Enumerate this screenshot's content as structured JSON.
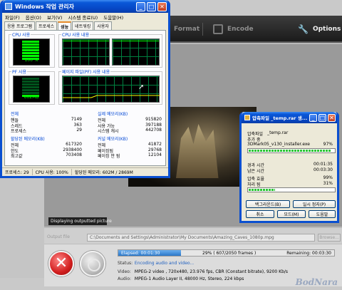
{
  "encoder": {
    "toolbar": {
      "format_label": "Format",
      "encode_label": "Encode",
      "options_label": "Options"
    },
    "preview_status": "Displaying outputted picture",
    "output_label": "Output file",
    "output_path": "C:\\Documents and Settings\\Administrator\\My Documents\\Amazing_Caves_1080p.mpg",
    "browse_label": "Browse...",
    "progress": {
      "elapsed": "Elapsed: 00:01:30",
      "frames": "29% ( 607/2050 frames )",
      "remaining": "Remaining: 00:03:30",
      "percent": 29
    },
    "status_key": "Status:",
    "status_val": "Encoding audio and video...",
    "video_key": "Video:",
    "video_val": "MPEG-2 video , 720x480, 23.976 fps, CBR (Constant bitrate), 9200 Kb/s",
    "audio_key": "Audio:",
    "audio_val": "MPEG-1 Audio Layer II, 48000 Hz, Stereo, 224 kbps",
    "watermark": "BodNara"
  },
  "taskmgr": {
    "title": "Windows 작업 관리자",
    "menu": [
      "파일(F)",
      "옵션(O)",
      "보기(V)",
      "시스템 종료(U)",
      "도움말(H)"
    ],
    "tabs": [
      "응용 프로그램",
      "프로세스",
      "성능",
      "네트워킹",
      "사용자"
    ],
    "cpu_usage_label": "CPU 사용",
    "cpu_usage_value": "100 %",
    "cpu_usage_level": 1.0,
    "cpu_history_label": "CPU 사용 내용",
    "pf_usage_label": "PF 사용",
    "pf_usage_value": "602MB",
    "pf_usage_level": 0.2,
    "pf_history_label": "페이지 파일(PF) 사용 내용",
    "totals": {
      "title": "전체",
      "rows": [
        {
          "k": "핸들",
          "v": "7149"
        },
        {
          "k": "스레드",
          "v": "363"
        },
        {
          "k": "프로세스",
          "v": "29"
        }
      ]
    },
    "physical": {
      "title": "실제 메모리(KB)",
      "rows": [
        {
          "k": "전체",
          "v": "915820"
        },
        {
          "k": "사용 가능",
          "v": "397188"
        },
        {
          "k": "시스템 캐시",
          "v": "442708"
        }
      ]
    },
    "commit": {
      "title": "할당된 메모리(KB)",
      "rows": [
        {
          "k": "전체",
          "v": "617320"
        },
        {
          "k": "한도",
          "v": "2938400"
        },
        {
          "k": "최고값",
          "v": "703408"
        }
      ]
    },
    "kernel": {
      "title": "커널 메모리(KB)",
      "rows": [
        {
          "k": "전체",
          "v": "41872"
        },
        {
          "k": "페이징됨",
          "v": "29768"
        },
        {
          "k": "페이징 안 됨",
          "v": "12104"
        }
      ]
    },
    "status": {
      "processes": "프로세스: 29",
      "cpu": "CPU 사용: 100%",
      "commit": "할당된 메모리: 602M / 2869M"
    }
  },
  "unzip": {
    "title": "압축파일 _temp.rar 생...",
    "archive_label": "압축파일",
    "archive_name": "_temp.rar",
    "adding_label": "추가 중",
    "file_name": "3DMark05_v130_installer.exe",
    "file_percent": "97%",
    "file_level": 0.97,
    "elapsed_label": "경과 시간",
    "elapsed_value": "00:01:35",
    "remaining_label": "남은 시간",
    "remaining_value": "00:03:30",
    "ratio_label": "압축 효율",
    "ratio_value": "99%",
    "processed_label": "처리 됨",
    "processed_value": "31%",
    "processed_level": 0.31,
    "buttons": {
      "background": "백그라운드(B)",
      "pause": "일시 정지(P)",
      "cancel": "취소",
      "mode": "모드(M)",
      "help": "도움말"
    }
  }
}
